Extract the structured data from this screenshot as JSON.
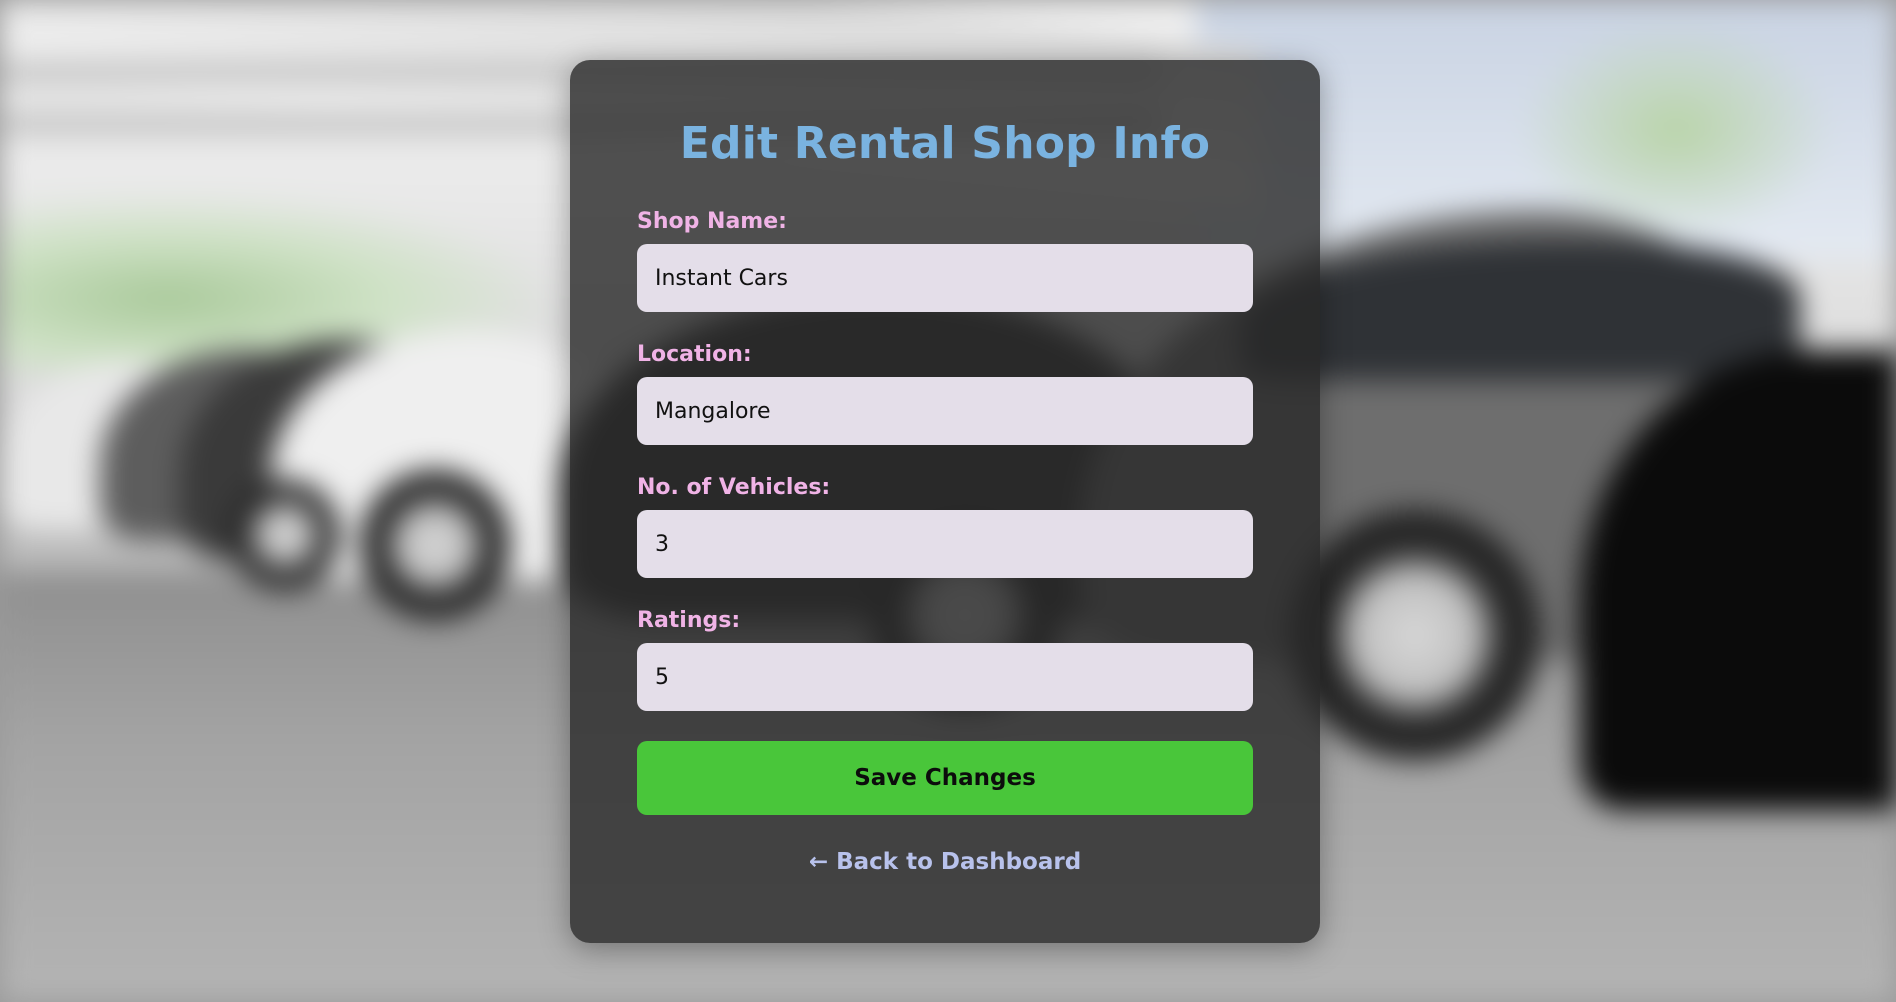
{
  "form": {
    "title": "Edit Rental Shop Info",
    "fields": [
      {
        "label": "Shop Name:",
        "value": "Instant Cars"
      },
      {
        "label": "Location:",
        "value": "Mangalore"
      },
      {
        "label": "No. of Vehicles:",
        "value": "3"
      },
      {
        "label": "Ratings:",
        "value": "5"
      }
    ],
    "save_label": "Save Changes",
    "back_link": "← Back to Dashboard"
  },
  "colors": {
    "title": "#7ab3e0",
    "labels": "#f0b3e6",
    "input_bg": "#e4dee9",
    "save_button": "#49c63a",
    "back_link": "#b8c2ec"
  }
}
